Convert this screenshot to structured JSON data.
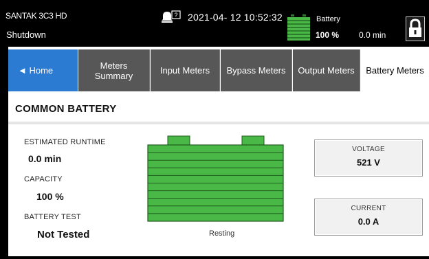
{
  "header": {
    "model": "SANTAK 3C3 HD",
    "status": "Shutdown",
    "datetime": "2021-04- 12 10:52:32",
    "battery": {
      "label": "Battery",
      "percent": "100 %",
      "runtime": "0.0 min",
      "level": 1.0
    },
    "icons": {
      "alarm": "alarm-help-icon",
      "lock": "padlock-icon",
      "battery": "battery-icon"
    }
  },
  "tabs": [
    {
      "label": "◄  Home"
    },
    {
      "label": "Meters Summary"
    },
    {
      "label": "Input Meters"
    },
    {
      "label": "Bypass Meters"
    },
    {
      "label": "Output Meters"
    },
    {
      "label": "Battery Meters"
    }
  ],
  "section": {
    "title": "COMMON BATTERY"
  },
  "battery": {
    "estimated_runtime": {
      "label": "ESTIMATED RUNTIME",
      "value": "0.0 min"
    },
    "capacity": {
      "label": "CAPACITY",
      "value": "100 %"
    },
    "battery_test": {
      "label": "BATTERY TEST",
      "value": "Not Tested"
    },
    "state": "Resting",
    "level": 1.0
  },
  "meters": {
    "voltage": {
      "label": "VOLTAGE",
      "value": "521 V"
    },
    "current": {
      "label": "CURRENT",
      "value": "0.0 A"
    }
  },
  "colors": {
    "home_tab": "#2a7bd1",
    "tab_dark": "#575757",
    "battery_green": "#49b847",
    "topbar": "#000000"
  }
}
